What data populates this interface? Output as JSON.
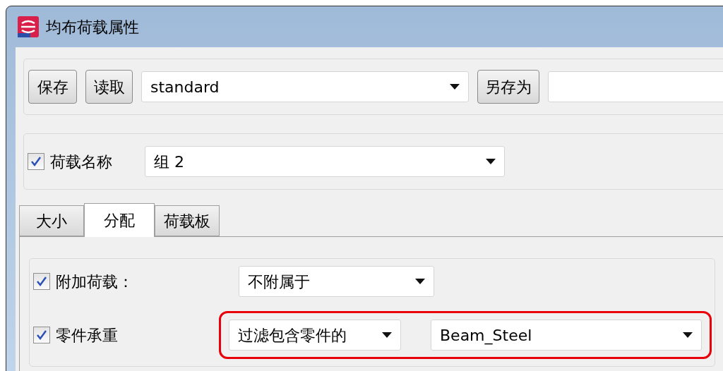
{
  "window": {
    "title": "均布荷载属性"
  },
  "toolbar": {
    "save_button": "保存",
    "load_button": "读取",
    "preset": "standard",
    "save_as_button": "另存为"
  },
  "load_name": {
    "checked": true,
    "label": "荷载名称",
    "value": "组 2"
  },
  "tabs": [
    {
      "label": "大小",
      "selected": false
    },
    {
      "label": "分配",
      "selected": true
    },
    {
      "label": "荷载板",
      "selected": false
    }
  ],
  "rows": [
    {
      "checked": true,
      "label": "附加荷载：",
      "highlighted": false,
      "dropdowns": [
        "不附属于"
      ]
    },
    {
      "checked": true,
      "label": "零件承重",
      "highlighted": true,
      "dropdowns": [
        "过滤包含零件的",
        "Beam_Steel"
      ]
    }
  ]
}
